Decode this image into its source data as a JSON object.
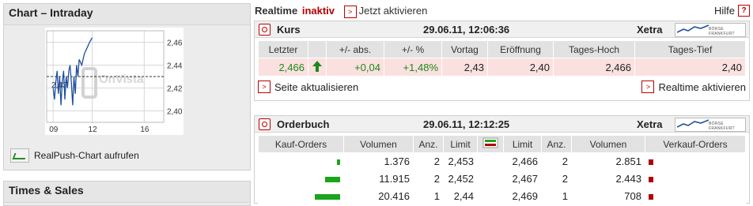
{
  "left": {
    "chart_title": "Chart – Intraday",
    "realpush_label": "RealPush-Chart aufrufen",
    "times_title": "Times & Sales",
    "watermark": "OnVista",
    "chart_data": {
      "type": "line",
      "x_ticks": [
        "09",
        "12",
        "16"
      ],
      "y_ticks": [
        "2,46",
        "2,44",
        "2,42",
        "2,40"
      ],
      "ylim": [
        2.39,
        2.47
      ],
      "reference_label": "2,43",
      "reference_value": 2.43,
      "series": [
        {
          "values": [
            [
              9.0,
              2.42
            ],
            [
              9.1,
              2.41
            ],
            [
              9.2,
              2.425
            ],
            [
              9.3,
              2.435
            ],
            [
              9.4,
              2.415
            ],
            [
              9.5,
              2.43
            ],
            [
              9.6,
              2.405
            ],
            [
              9.7,
              2.425
            ],
            [
              9.8,
              2.435
            ],
            [
              9.9,
              2.41
            ],
            [
              10.0,
              2.43
            ],
            [
              10.1,
              2.42
            ],
            [
              10.2,
              2.435
            ],
            [
              10.3,
              2.44
            ],
            [
              10.4,
              2.425
            ],
            [
              10.5,
              2.405
            ],
            [
              10.6,
              2.43
            ],
            [
              10.7,
              2.415
            ],
            [
              10.8,
              2.44
            ],
            [
              10.9,
              2.43
            ],
            [
              11.0,
              2.445
            ],
            [
              11.2,
              2.44
            ],
            [
              11.4,
              2.45
            ],
            [
              11.6,
              2.455
            ],
            [
              11.8,
              2.46
            ],
            [
              12.0,
              2.464
            ]
          ]
        }
      ]
    }
  },
  "realtime": {
    "label": "Realtime",
    "status": "inaktiv",
    "activate_label": "Jetzt aktivieren",
    "help_label": "Hilfe"
  },
  "kurs": {
    "title": "Kurs",
    "datetime": "29.06.11, 12:06:36",
    "exchange": "Xetra",
    "logo_text": "BÖRSE FRANKFURT",
    "headers": [
      "Letzter",
      "",
      "+/- abs.",
      "+/- %",
      "Vortag",
      "Eröffnung",
      "Tages-Hoch",
      "Tages-Tief"
    ],
    "values": [
      "2,466",
      "",
      "+0,04",
      "+1,48%",
      "2,43",
      "2,40",
      "2,466",
      "2,40"
    ],
    "refresh_label": "Seite aktualisieren",
    "realtime_activate_label": "Realtime aktivieren",
    "colors": {
      "positive": "#1a8a1a",
      "negative": "#b00000"
    }
  },
  "orderbook": {
    "title": "Orderbuch",
    "datetime": "29.06.11, 12:12:25",
    "exchange": "Xetra",
    "logo_text": "BÖRSE FRANKFURT",
    "headers": [
      "Kauf-Orders",
      "Volumen",
      "Anz.",
      "Limit",
      "",
      "Limit",
      "Anz.",
      "Volumen",
      "Verkauf-Orders"
    ],
    "rows": [
      {
        "buy_volume": "1.376",
        "buy_count": "2",
        "buy_limit": "2,453",
        "sell_limit": "2,466",
        "sell_count": "2",
        "sell_volume": "2.851",
        "buy_bar": 0.07
      },
      {
        "buy_volume": "11.915",
        "buy_count": "2",
        "buy_limit": "2,452",
        "sell_limit": "2,467",
        "sell_count": "2",
        "sell_volume": "2.443",
        "buy_bar": 0.6
      },
      {
        "buy_volume": "20.416",
        "buy_count": "1",
        "buy_limit": "2,44",
        "sell_limit": "2,469",
        "sell_count": "1",
        "sell_volume": "708",
        "buy_bar": 1.0
      }
    ]
  }
}
